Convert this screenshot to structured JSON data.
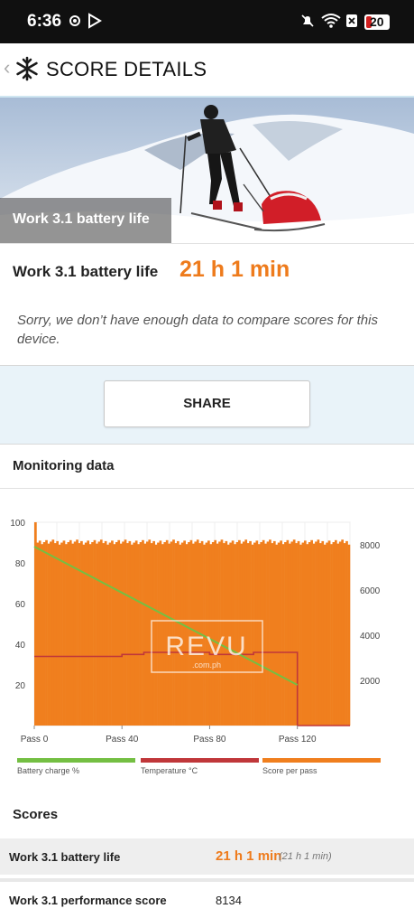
{
  "status_bar": {
    "time": "6:36",
    "battery": "20"
  },
  "header": {
    "title": "SCORE DETAILS",
    "back_glyph": "‹"
  },
  "hero": {
    "label": "Work 3.1 battery life",
    "version": "3.1"
  },
  "result": {
    "label": "Work 3.1 battery life",
    "value": "21 h 1 min"
  },
  "note": "Sorry, we don’t have enough data to compare scores for this device.",
  "share_label": "SHARE",
  "monitoring": {
    "title": "Monitoring data"
  },
  "chart_data": {
    "type": "bar",
    "title": "",
    "watermark": {
      "text": "REVU",
      "subtext": ".com.ph"
    },
    "x_ticks": [
      "Pass 0",
      "Pass 40",
      "Pass 80",
      "Pass 120"
    ],
    "y_left_ticks": [
      "100",
      "80",
      "60",
      "40",
      "20"
    ],
    "y_right_ticks": [
      "8000",
      "6000",
      "4000",
      "2000"
    ],
    "y_left_range": [
      0,
      100
    ],
    "y_right_range": [
      0,
      9000
    ],
    "passes": 144,
    "score_per_pass": {
      "name": "Score per pass",
      "color": "#f07f1e",
      "typical": 8130,
      "first_pass": 9000,
      "range": [
        7950,
        8300
      ]
    },
    "battery_charge": {
      "name": "Battery charge %",
      "color": "#74bf43",
      "start": 88,
      "end": 20,
      "end_pass": 120
    },
    "temperature": {
      "name": "Temperature °C",
      "color": "#c0373a",
      "values_y_left": [
        34,
        34,
        34,
        34,
        35,
        36,
        36,
        36,
        35,
        35,
        36,
        36,
        35,
        0
      ]
    },
    "legend": [
      "Battery charge %",
      "Temperature °C",
      "Score per pass"
    ]
  },
  "scores": {
    "title": "Scores",
    "rows": [
      {
        "label": "Work 3.1 battery life",
        "value": "21 h 1 min",
        "secondary": "(21 h 1 min)"
      },
      {
        "label": "Work 3.1 performance score",
        "value": "8134"
      }
    ]
  },
  "colors": {
    "accent": "#ee7b1c",
    "status_bg": "#101010",
    "page_bg": "#e9f3f9"
  }
}
